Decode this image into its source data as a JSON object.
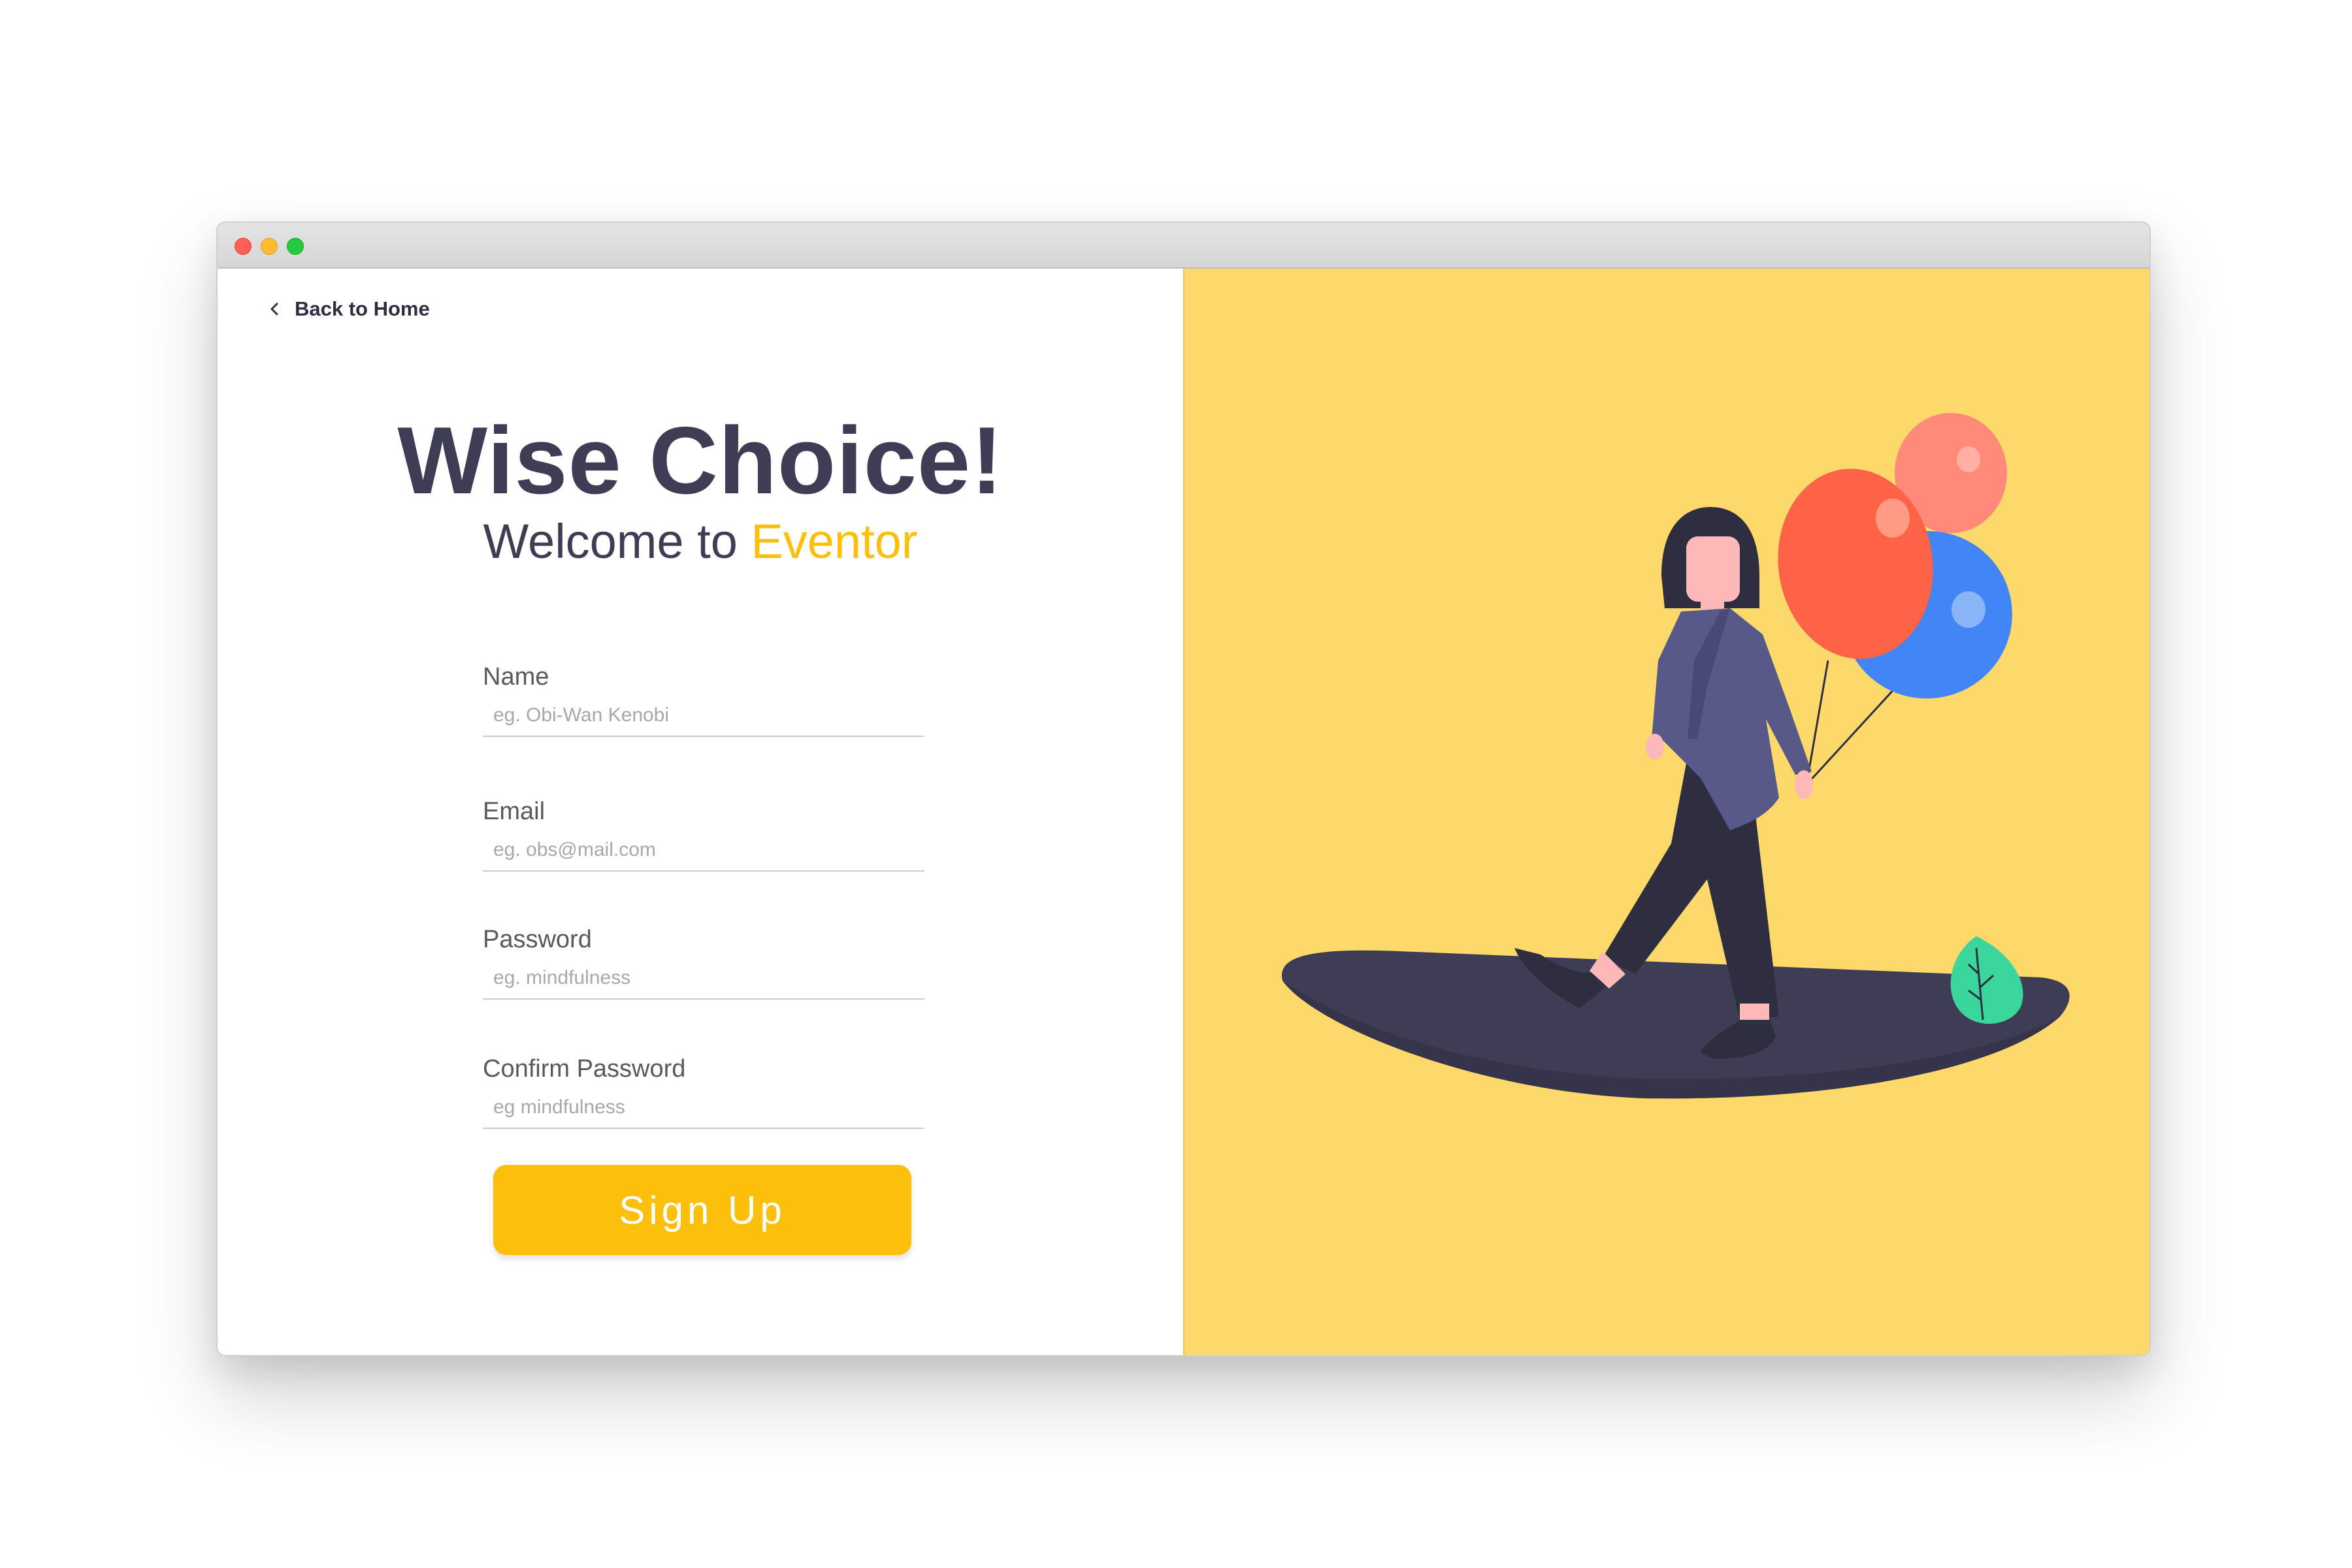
{
  "window": {
    "traffic_lights": [
      "close",
      "minimize",
      "zoom"
    ]
  },
  "nav": {
    "back_label": "Back to Home",
    "back_icon": "chevron-left-icon"
  },
  "header": {
    "title": "Wise Choice!",
    "subtitle_prefix": "Welcome to ",
    "brand": "Eventor"
  },
  "form": {
    "fields": [
      {
        "label": "Name",
        "placeholder": "eg. Obi-Wan Kenobi",
        "value": ""
      },
      {
        "label": "Email",
        "placeholder": "eg. obs@mail.com",
        "value": ""
      },
      {
        "label": "Password",
        "placeholder": "eg. mindfulness",
        "value": ""
      },
      {
        "label": "Confirm Password",
        "placeholder": "eg mindfulness",
        "value": ""
      }
    ],
    "submit_label": "Sign Up"
  },
  "colors": {
    "accent": "#fbbf0c",
    "illustration_bg": "#fdd96b",
    "text_dark": "#3f3d56",
    "balloon_red": "#ff6347",
    "balloon_pink": "#ff8a7a",
    "balloon_blue": "#4285f4",
    "leaf": "#3bd69b"
  }
}
